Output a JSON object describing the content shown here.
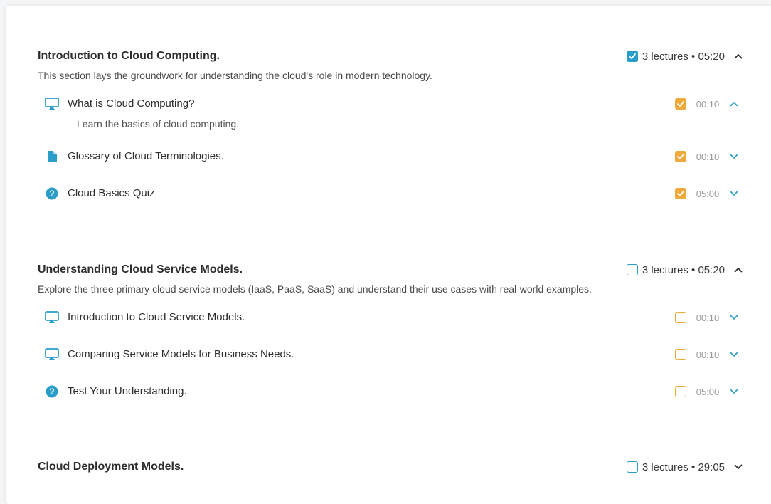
{
  "colors": {
    "accent_teal": "#2a9ec9",
    "accent_orange": "#f0a93b",
    "divider": "#e3e3e3"
  },
  "sections": [
    {
      "title": "Introduction to Cloud Computing.",
      "description": "This section lays the groundwork for understanding the cloud's role in modern technology.",
      "meta": "3 lectures • 05:20",
      "completed": true,
      "expanded": true,
      "lectures": [
        {
          "icon": "presentation-icon",
          "title": "What is Cloud Computing?",
          "description": "Learn the basics of cloud computing.",
          "duration": "00:10",
          "completed": true,
          "expanded": true
        },
        {
          "icon": "document-icon",
          "title": "Glossary of Cloud Terminologies.",
          "duration": "00:10",
          "completed": true,
          "expanded": false
        },
        {
          "icon": "quiz-icon",
          "title": "Cloud Basics Quiz",
          "duration": "05:00",
          "completed": true,
          "expanded": false
        }
      ]
    },
    {
      "title": "Understanding Cloud Service Models.",
      "description": "Explore the three primary cloud service models (IaaS, PaaS, SaaS) and understand their use cases with real-world examples.",
      "meta": "3 lectures • 05:20",
      "completed": false,
      "expanded": true,
      "lectures": [
        {
          "icon": "presentation-icon",
          "title": "Introduction to Cloud Service Models.",
          "duration": "00:10",
          "completed": false,
          "expanded": false
        },
        {
          "icon": "presentation-icon",
          "title": "Comparing Service Models for Business Needs.",
          "duration": "00:10",
          "completed": false,
          "expanded": false
        },
        {
          "icon": "quiz-icon",
          "title": "Test Your Understanding.",
          "duration": "05:00",
          "completed": false,
          "expanded": false
        }
      ]
    },
    {
      "title": "Cloud Deployment Models.",
      "meta": "3 lectures • 29:05",
      "completed": false,
      "expanded": false
    }
  ]
}
